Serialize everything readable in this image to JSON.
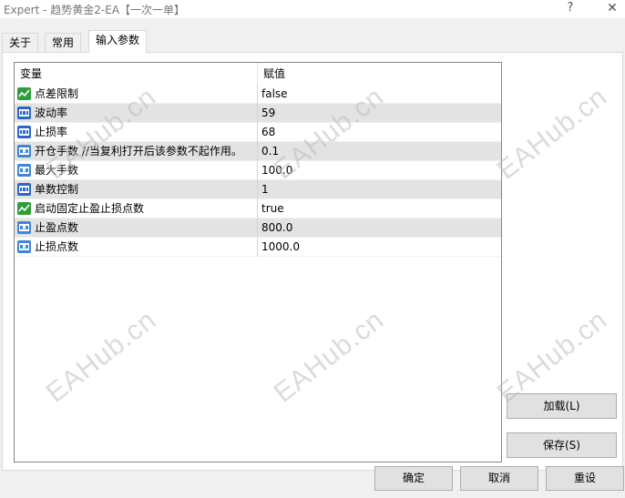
{
  "window": {
    "title": "Expert - 趋势黄金2-EA【一次一单】",
    "help_glyph": "?",
    "close_glyph": "✕"
  },
  "tabs": [
    {
      "label": "关于",
      "active": false
    },
    {
      "label": "常用",
      "active": false
    },
    {
      "label": "输入参数",
      "active": true
    }
  ],
  "grid": {
    "columns": [
      "变量",
      "赋值"
    ],
    "rows": [
      {
        "name": "点差限制",
        "value": "false",
        "icon": "bool-icon"
      },
      {
        "name": "波动率",
        "value": "59",
        "icon": "int-icon"
      },
      {
        "name": "止损率",
        "value": "68",
        "icon": "int-icon"
      },
      {
        "name": "开仓手数 //当复利打开后该参数不起作用。",
        "value": "0.1",
        "icon": "double-icon"
      },
      {
        "name": "最大手数",
        "value": "100.0",
        "icon": "double-icon"
      },
      {
        "name": "单数控制",
        "value": "1",
        "icon": "int-icon"
      },
      {
        "name": "启动固定止盈止损点数",
        "value": "true",
        "icon": "bool-icon"
      },
      {
        "name": "止盈点数",
        "value": "800.0",
        "icon": "double-icon"
      },
      {
        "name": "止损点数",
        "value": "1000.0",
        "icon": "double-icon"
      }
    ]
  },
  "buttons": {
    "load": "加载(L)",
    "save": "保存(S)",
    "ok": "确定",
    "cancel": "取消",
    "reset": "重设"
  },
  "watermark": "EAHub.cn",
  "colors": {
    "bool_icon": "#2e9e3a",
    "int_icon": "#2a66c8",
    "double_icon": "#3f86d6",
    "row_alt": "#e3e3e3"
  }
}
